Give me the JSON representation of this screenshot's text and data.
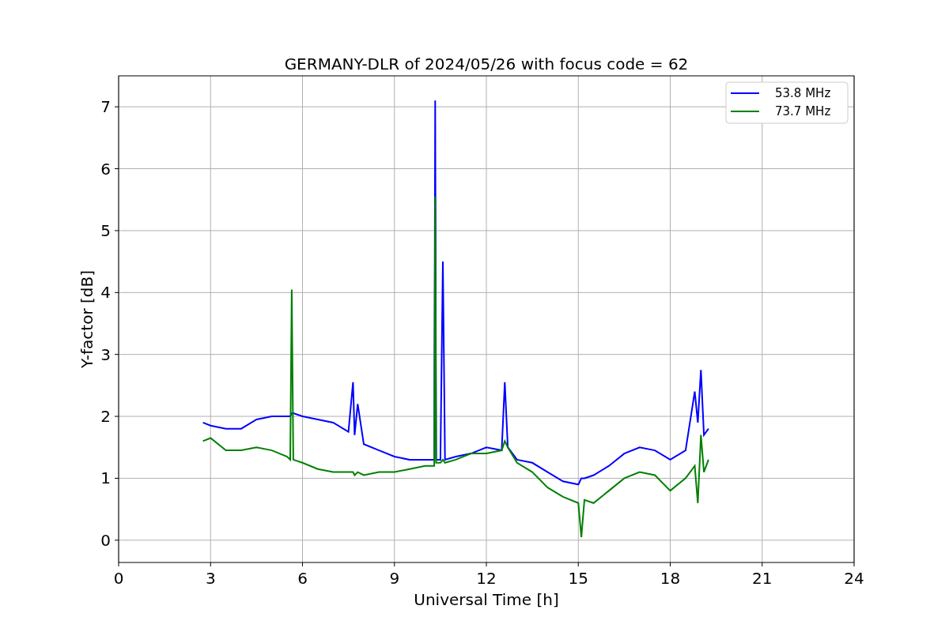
{
  "figure": {
    "chart_data": {
      "type": "line",
      "title": "GERMANY-DLR of 2024/05/26 with focus code = 62",
      "xlabel": "Universal Time [h]",
      "ylabel": "Y-factor [dB]",
      "x": [
        2.75,
        3,
        3.5,
        4,
        4.5,
        5,
        5.5,
        5.6,
        5.65,
        5.7,
        6,
        6.5,
        7,
        7.5,
        7.65,
        7.7,
        7.8,
        8,
        8.5,
        9,
        9.5,
        10,
        10.3,
        10.33,
        10.36,
        10.5,
        10.58,
        10.65,
        11,
        11.5,
        12,
        12.5,
        12.6,
        12.7,
        13,
        13.5,
        14,
        14.5,
        15,
        15.1,
        15.2,
        15.5,
        16,
        16.5,
        17,
        17.5,
        18,
        18.5,
        18.8,
        18.9,
        19,
        19.1,
        19.25
      ],
      "series": [
        {
          "name": "53.8 MHz",
          "color": "#0000ff",
          "values": [
            1.9,
            1.85,
            1.8,
            1.8,
            1.95,
            2.0,
            2.0,
            2.0,
            2.05,
            2.05,
            2.0,
            1.95,
            1.9,
            1.75,
            2.55,
            1.7,
            2.2,
            1.55,
            1.45,
            1.35,
            1.3,
            1.3,
            1.3,
            7.1,
            1.3,
            1.3,
            4.5,
            1.3,
            1.35,
            1.4,
            1.5,
            1.45,
            2.55,
            1.5,
            1.3,
            1.25,
            1.1,
            0.95,
            0.9,
            1.0,
            1.0,
            1.05,
            1.2,
            1.4,
            1.5,
            1.45,
            1.3,
            1.45,
            2.4,
            1.9,
            2.75,
            1.7,
            1.8
          ]
        },
        {
          "name": "73.7 MHz",
          "color": "#008000",
          "values": [
            1.6,
            1.65,
            1.45,
            1.45,
            1.5,
            1.45,
            1.35,
            1.3,
            4.05,
            1.3,
            1.25,
            1.15,
            1.1,
            1.1,
            1.1,
            1.05,
            1.1,
            1.05,
            1.1,
            1.1,
            1.15,
            1.2,
            1.2,
            5.55,
            1.25,
            1.25,
            1.3,
            1.25,
            1.3,
            1.4,
            1.4,
            1.45,
            1.6,
            1.5,
            1.25,
            1.1,
            0.85,
            0.7,
            0.6,
            0.05,
            0.65,
            0.6,
            0.8,
            1.0,
            1.1,
            1.05,
            0.8,
            1.0,
            1.2,
            0.6,
            1.7,
            1.1,
            1.3
          ]
        }
      ],
      "xlim": [
        0,
        24
      ],
      "ylim": [
        -0.36,
        7.5
      ],
      "xticks": [
        0,
        3,
        6,
        9,
        12,
        15,
        18,
        21,
        24
      ],
      "yticks": [
        0,
        1,
        2,
        3,
        4,
        5,
        6,
        7
      ],
      "grid": true,
      "legend": true
    }
  }
}
